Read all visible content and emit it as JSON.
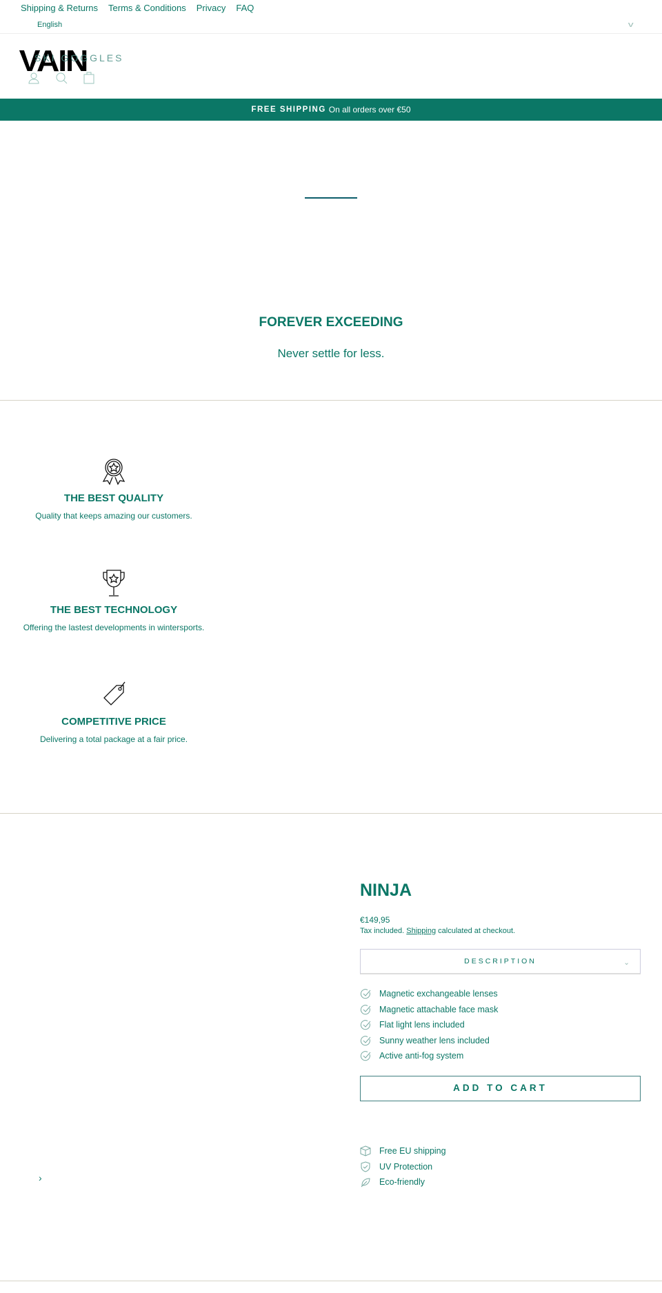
{
  "top_nav": {
    "links": [
      "Shipping & Returns",
      "Terms & Conditions",
      "Privacy",
      "FAQ"
    ],
    "language": "English"
  },
  "header": {
    "logo": "VAIN",
    "nav_link": "SKI GOGGLES",
    "icons": [
      "account-icon",
      "search-icon",
      "cart-icon"
    ]
  },
  "banner": {
    "bold": "FREE SHIPPING",
    "text": "On all orders over €50"
  },
  "hero": {
    "title": "FOREVER EXCEEDING",
    "subtitle": "Never settle for less."
  },
  "features": [
    {
      "icon": "award-ribbon-icon",
      "title": "THE BEST QUALITY",
      "text": "Quality that keeps amazing our customers."
    },
    {
      "icon": "trophy-icon",
      "title": "THE BEST TECHNOLOGY",
      "text": "Offering the lastest developments in wintersports."
    },
    {
      "icon": "price-tag-icon",
      "title": "COMPETITIVE PRICE",
      "text": "Delivering a total package at a fair price."
    }
  ],
  "product": {
    "title": "NINJA",
    "price": "€149,95",
    "tax_prefix": "Tax included.",
    "tax_link": "Shipping",
    "tax_suffix": "calculated at checkout.",
    "description_label": "DESCRIPTION",
    "bullets": [
      "Magnetic exchangeable lenses",
      "Magnetic attachable face mask",
      "Flat light lens included",
      "Sunny weather lens included",
      "Active anti-fog system"
    ],
    "add_to_cart": "ADD TO CART",
    "perks": [
      {
        "icon": "box-icon",
        "text": "Free EU shipping"
      },
      {
        "icon": "shield-icon",
        "text": "UV Protection"
      },
      {
        "icon": "leaf-icon",
        "text": "Eco-friendly"
      }
    ],
    "gallery_next": "›"
  },
  "colors": {
    "accent": "#0b7766",
    "divider": "#d6d3c6"
  }
}
